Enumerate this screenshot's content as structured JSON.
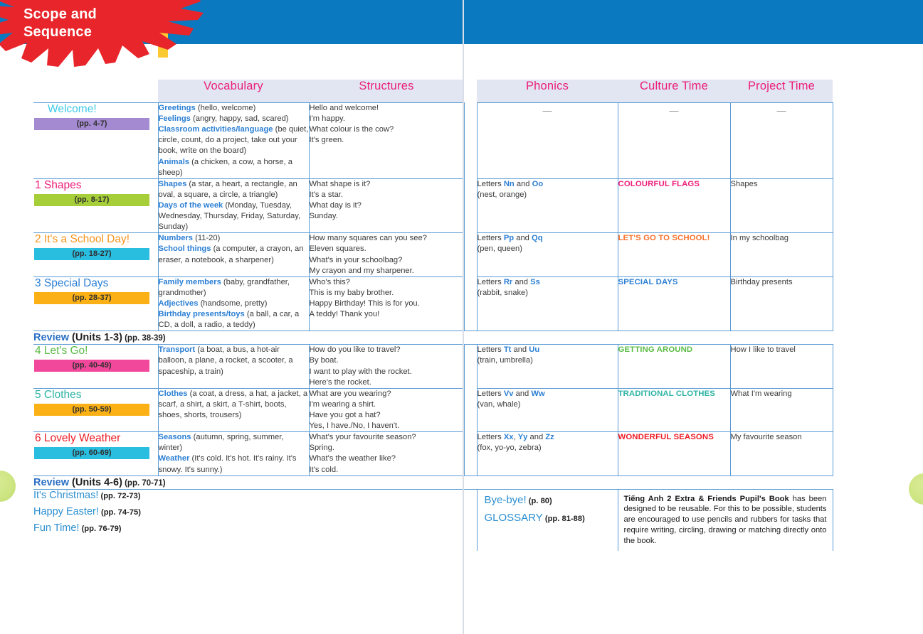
{
  "banner": {
    "title_line1": "Scope and",
    "title_line2": "Sequence",
    "splash_color": "#e8252a",
    "banner_color": "#0b79bf",
    "stripe_color": "#fbc932"
  },
  "table": {
    "headers": {
      "vocabulary": "Vocabulary",
      "structures": "Structures",
      "phonics": "Phonics",
      "culture": "Culture Time",
      "project": "Project Time",
      "header_color": "#ec1e79",
      "header_bg": "#e2e6f3"
    },
    "rows": [
      {
        "num": "",
        "title": "Welcome!",
        "title_color": "#3ec8e8",
        "pages": "(pp. 4-7)",
        "bar_color": "#a48ad0",
        "vocab": [
          {
            "key": "Greetings",
            "rest": " (hello, welcome)"
          },
          {
            "key": "Feelings",
            "rest": " (angry, happy, sad, scared)"
          },
          {
            "key": "Classroom activities/language",
            "rest": " (be quiet, circle, count, do a project, take out your book, write on the board)"
          },
          {
            "key": "Animals",
            "rest": " (a chicken, a cow, a horse, a sheep)"
          }
        ],
        "structures": [
          "Hello and welcome!",
          "I'm happy.",
          "What colour is the cow?",
          "It's green."
        ],
        "phonics": [],
        "phonics_dash": "—",
        "culture": "",
        "culture_dash": "—",
        "culture_color": "#888888",
        "project": "",
        "project_dash": "—"
      },
      {
        "num": "1",
        "title": "Shapes",
        "title_color": "#ec1e79",
        "pages": "(pp. 8-17)",
        "bar_color": "#a6ce39",
        "vocab": [
          {
            "key": "Shapes",
            "rest": " (a star, a heart, a rectangle, an oval, a square, a circle, a triangle)"
          },
          {
            "key": "Days of the week",
            "rest": " (Monday, Tuesday, Wednesday, Thursday, Friday, Saturday, Sunday)"
          }
        ],
        "structures": [
          "What shape is it?",
          "It's a star.",
          "What day is it?",
          "Sunday."
        ],
        "phonics_letters_prefix": "Letters ",
        "phonics_a": "Nn",
        "phonics_mid": " and ",
        "phonics_b": "Oo",
        "phonics_examples": "(nest, orange)",
        "culture": "COLOURFUL FLAGS",
        "culture_color": "#ec1e79",
        "project": "Shapes"
      },
      {
        "num": "2",
        "title": "It's a School Day!",
        "title_color": "#f7941e",
        "pages": "(pp. 18-27)",
        "bar_color": "#29bde0",
        "vocab": [
          {
            "key": "Numbers",
            "rest": " (11-20)"
          },
          {
            "key": "School things",
            "rest": " (a computer, a crayon, an eraser, a notebook, a sharpener)"
          }
        ],
        "structures": [
          "How many squares can you see?",
          "Eleven squares.",
          "What's in your schoolbag?",
          "My crayon and my sharpener."
        ],
        "phonics_letters_prefix": "Letters ",
        "phonics_a": "Pp",
        "phonics_mid": " and ",
        "phonics_b": "Qq",
        "phonics_examples": "(pen, queen)",
        "culture": "LET'S GO TO SCHOOL!",
        "culture_color": "#f7702a",
        "project": "In my schoolbag"
      },
      {
        "num": "3",
        "title": "Special Days",
        "title_color": "#2b7fd4",
        "pages": "(pp. 28-37)",
        "bar_color": "#fbb116",
        "vocab": [
          {
            "key": "Family members",
            "rest": " (baby, grandfather, grandmother)"
          },
          {
            "key": "Adjectives",
            "rest": " (handsome, pretty)"
          },
          {
            "key": "Birthday presents/toys",
            "rest": " (a ball, a car, a CD, a doll, a radio, a teddy)"
          }
        ],
        "structures": [
          "Who's this?",
          "This is my baby brother.",
          "Happy Birthday! This is for you.",
          "A teddy! Thank you!"
        ],
        "phonics_letters_prefix": "Letters ",
        "phonics_a": "Rr",
        "phonics_mid": " and ",
        "phonics_b": "Ss",
        "phonics_examples": "(rabbit, snake)",
        "culture": "SPECIAL DAYS",
        "culture_color": "#2b7fd4",
        "project": "Birthday presents"
      },
      {
        "num": "4",
        "title": "Let's Go!",
        "title_color": "#5bbb46",
        "pages": "(pp. 40-49)",
        "bar_color": "#f2489b",
        "vocab": [
          {
            "key": "Transport",
            "rest": " (a boat, a bus, a hot-air balloon, a plane, a rocket, a scooter, a spaceship, a train)"
          }
        ],
        "structures": [
          "How do you like to travel?",
          "By boat.",
          "I want to play with the rocket.",
          "Here's the rocket."
        ],
        "phonics_letters_prefix": "Letters ",
        "phonics_a": "Tt",
        "phonics_mid": " and ",
        "phonics_b": "Uu",
        "phonics_examples": "(train, umbrella)",
        "culture": "GETTING AROUND",
        "culture_color": "#5bbb46",
        "project": "How I like to travel"
      },
      {
        "num": "5",
        "title": "Clothes",
        "title_color": "#2bb3a3",
        "pages": "(pp. 50-59)",
        "bar_color": "#fbb116",
        "vocab": [
          {
            "key": "Clothes",
            "rest": " (a coat, a dress, a hat, a jacket, a scarf, a shirt, a skirt, a T-shirt, boots, shoes, shorts, trousers)"
          }
        ],
        "structures": [
          "What are you wearing?",
          "I'm wearing a shirt.",
          "Have you got a hat?",
          "Yes, I have./No, I haven't."
        ],
        "phonics_letters_prefix": "Letters ",
        "phonics_a": "Vv",
        "phonics_mid": " and ",
        "phonics_b": "Ww",
        "phonics_examples": "(van, whale)",
        "culture": "TRADITIONAL CLOTHES",
        "culture_color": "#2bb3a3",
        "project": "What I'm wearing"
      },
      {
        "num": "6",
        "title": "Lovely Weather",
        "title_color": "#ed1c24",
        "pages": "(pp. 60-69)",
        "bar_color": "#29bde0",
        "vocab": [
          {
            "key": "Seasons",
            "rest": " (autumn, spring, summer, winter)"
          },
          {
            "key": "Weather",
            "rest": " (It's cold. It's hot. It's rainy. It's snowy. It's sunny.)"
          }
        ],
        "structures": [
          "What's your favourite season?",
          "Spring.",
          "What's the weather like?",
          "It's cold."
        ],
        "phonics_letters_prefix": "Letters ",
        "phonics_a": "Xx",
        "phonics_mid2": ", ",
        "phonics_b": "Yy",
        "phonics_mid": " and ",
        "phonics_c": "Zz",
        "phonics_examples": "(fox, yo-yo, zebra)",
        "culture": "WONDERFUL SEASONS",
        "culture_color": "#ed1c24",
        "project": "My favourite season"
      }
    ],
    "review1": {
      "lead": "Review",
      "units": " (Units 1-3)",
      "pages": " (pp. 38-39)"
    },
    "review2": {
      "lead": "Review",
      "units": " (Units 4-6)",
      "pages": " (pp. 70-71)"
    }
  },
  "extras": {
    "left": [
      {
        "title": "It's Christmas!",
        "pages": " (pp. 72-73)"
      },
      {
        "title": "Happy Easter!",
        "pages": " (pp. 74-75)"
      },
      {
        "title": "Fun Time!",
        "pages": " (pp. 76-79)"
      }
    ],
    "right": [
      {
        "title": "Bye-bye!",
        "pages": " (p. 80)"
      },
      {
        "title": "GLOSSARY",
        "pages": " (pp. 81-88)"
      }
    ],
    "note_bold": "Tiếng Anh 2 Extra & Friends Pupil's Book",
    "note_rest": " has been designed to be reusable. For this to be possible, students are encouraged to use pencils and rubbers for tasks that require writing, circling, drawing or matching directly onto the book."
  }
}
